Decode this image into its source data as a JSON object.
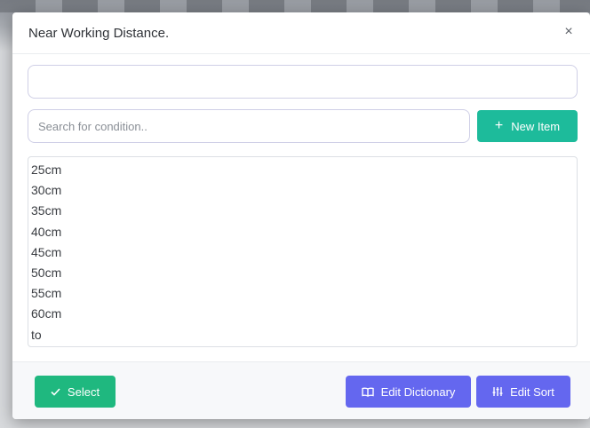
{
  "modal": {
    "title": "Near Working Distance.",
    "close_symbol": "×"
  },
  "top_input": {
    "value": "",
    "placeholder": ""
  },
  "search": {
    "value": "",
    "placeholder": "Search for condition.."
  },
  "new_item_button": {
    "label": "New Item",
    "icon": "plus-icon",
    "color": "#1dbb9b"
  },
  "items": [
    "25cm",
    "30cm",
    "35cm",
    "40cm",
    "45cm",
    "50cm",
    "55cm",
    "60cm",
    "to"
  ],
  "footer": {
    "select_label": "Select",
    "select_icon": "check-icon",
    "select_color": "#1fb87f",
    "edit_dictionary_label": "Edit Dictionary",
    "edit_dictionary_icon": "book-icon",
    "edit_sort_label": "Edit Sort",
    "edit_sort_icon": "sort-icon",
    "accent_color": "#6467ef"
  }
}
